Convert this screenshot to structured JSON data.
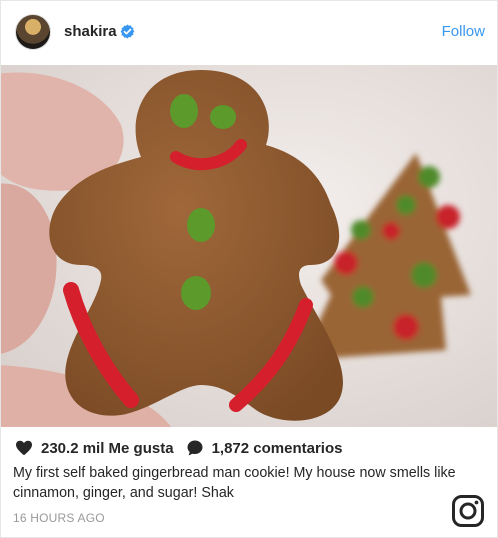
{
  "header": {
    "username": "shakira",
    "follow_label": "Follow"
  },
  "actions": {
    "likes": "230.2 mil Me gusta",
    "comments": "1,872 comentarios"
  },
  "caption": "My first self baked gingerbread man cookie! My house now smells like cinnamon, ginger, and sugar! Shak",
  "timestamp": "16 HOURS AGO",
  "colors": {
    "accent": "#3897f0",
    "text": "#262626",
    "muted": "#999999"
  },
  "icons": [
    "verified-badge-icon",
    "heart-icon",
    "comment-icon",
    "instagram-logo-icon"
  ]
}
